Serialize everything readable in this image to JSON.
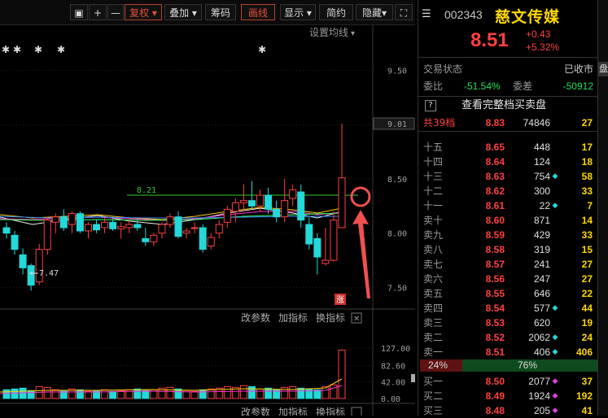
{
  "toolbar": {
    "buttons": [
      "复权",
      "叠加",
      "筹码",
      "画线",
      "显示",
      "简约",
      "隐藏"
    ],
    "active": [
      "复权",
      "画线"
    ]
  },
  "chart": {
    "ma_setting": "设置均线",
    "y_ticks": [
      "9.50",
      "9.00",
      "8.50",
      "8.00",
      "7.50"
    ],
    "current_price_tag": "9.01",
    "hline_label": "8.21",
    "low_label": "7.47",
    "limit_badge": "涨",
    "sub_tools": [
      "改参数",
      "加指标",
      "换指标"
    ],
    "vol_ticks": [
      "127.00",
      "82.60",
      "42.00",
      "0.00"
    ]
  },
  "chart_data": {
    "type": "candlestick",
    "price_range": [
      7.3,
      9.7
    ],
    "ohlc": [
      {
        "o": 8.05,
        "h": 8.1,
        "l": 7.95,
        "c": 8.0
      },
      {
        "o": 7.98,
        "h": 8.02,
        "l": 7.8,
        "c": 7.85
      },
      {
        "o": 7.8,
        "h": 7.86,
        "l": 7.62,
        "c": 7.68
      },
      {
        "o": 7.7,
        "h": 7.72,
        "l": 7.47,
        "c": 7.52
      },
      {
        "o": 7.55,
        "h": 7.9,
        "l": 7.52,
        "c": 7.85
      },
      {
        "o": 7.85,
        "h": 8.15,
        "l": 7.8,
        "c": 8.12
      },
      {
        "o": 8.1,
        "h": 8.18,
        "l": 8.0,
        "c": 8.15
      },
      {
        "o": 8.15,
        "h": 8.22,
        "l": 8.02,
        "c": 8.05
      },
      {
        "o": 8.08,
        "h": 8.2,
        "l": 8.0,
        "c": 8.18
      },
      {
        "o": 8.18,
        "h": 8.2,
        "l": 8.0,
        "c": 8.02
      },
      {
        "o": 8.02,
        "h": 8.1,
        "l": 7.95,
        "c": 8.08
      },
      {
        "o": 8.08,
        "h": 8.12,
        "l": 8.0,
        "c": 8.03
      },
      {
        "o": 8.05,
        "h": 8.15,
        "l": 8.0,
        "c": 8.1
      },
      {
        "o": 8.1,
        "h": 8.15,
        "l": 8.02,
        "c": 8.04
      },
      {
        "o": 8.04,
        "h": 8.1,
        "l": 7.95,
        "c": 8.06
      },
      {
        "o": 8.05,
        "h": 8.12,
        "l": 8.0,
        "c": 8.08
      },
      {
        "o": 8.08,
        "h": 8.12,
        "l": 8.02,
        "c": 8.05
      },
      {
        "o": 7.95,
        "h": 8.05,
        "l": 7.88,
        "c": 7.92
      },
      {
        "o": 7.92,
        "h": 8.0,
        "l": 7.88,
        "c": 7.98
      },
      {
        "o": 8.0,
        "h": 8.1,
        "l": 7.95,
        "c": 8.08
      },
      {
        "o": 8.08,
        "h": 8.18,
        "l": 8.05,
        "c": 8.15
      },
      {
        "o": 8.15,
        "h": 8.2,
        "l": 7.95,
        "c": 7.97
      },
      {
        "o": 8.0,
        "h": 8.05,
        "l": 7.95,
        "c": 8.02
      },
      {
        "o": 8.05,
        "h": 8.1,
        "l": 8.0,
        "c": 8.05
      },
      {
        "o": 8.05,
        "h": 8.08,
        "l": 7.82,
        "c": 7.85
      },
      {
        "o": 7.88,
        "h": 8.0,
        "l": 7.85,
        "c": 7.96
      },
      {
        "o": 8.0,
        "h": 8.12,
        "l": 7.95,
        "c": 8.08
      },
      {
        "o": 8.1,
        "h": 8.25,
        "l": 8.05,
        "c": 8.22
      },
      {
        "o": 8.2,
        "h": 8.32,
        "l": 8.1,
        "c": 8.28
      },
      {
        "o": 8.28,
        "h": 8.45,
        "l": 8.2,
        "c": 8.3
      },
      {
        "o": 8.3,
        "h": 8.48,
        "l": 8.22,
        "c": 8.25
      },
      {
        "o": 8.25,
        "h": 8.4,
        "l": 8.2,
        "c": 8.35
      },
      {
        "o": 8.35,
        "h": 8.42,
        "l": 8.18,
        "c": 8.22
      },
      {
        "o": 8.22,
        "h": 8.3,
        "l": 8.1,
        "c": 8.15
      },
      {
        "o": 8.15,
        "h": 8.5,
        "l": 8.1,
        "c": 8.3
      },
      {
        "o": 8.32,
        "h": 8.45,
        "l": 8.25,
        "c": 8.4
      },
      {
        "o": 8.38,
        "h": 8.45,
        "l": 8.05,
        "c": 8.12
      },
      {
        "o": 8.08,
        "h": 8.15,
        "l": 7.85,
        "c": 7.9
      },
      {
        "o": 7.95,
        "h": 8.0,
        "l": 7.62,
        "c": 7.78
      },
      {
        "o": 7.72,
        "h": 8.05,
        "l": 7.7,
        "c": 7.75
      },
      {
        "o": 7.75,
        "h": 8.2,
        "l": 7.74,
        "c": 8.12
      },
      {
        "o": 8.05,
        "h": 9.01,
        "l": 8.05,
        "c": 8.51
      }
    ],
    "volumes": [
      22,
      24,
      26,
      20,
      30,
      28,
      22,
      20,
      24,
      22,
      18,
      20,
      22,
      18,
      20,
      22,
      24,
      20,
      22,
      26,
      28,
      24,
      20,
      18,
      22,
      24,
      26,
      30,
      28,
      32,
      30,
      24,
      26,
      22,
      28,
      30,
      26,
      24,
      22,
      30,
      34,
      122
    ]
  },
  "quote": {
    "code": "002343",
    "name": "慈文传媒",
    "price": "8.51",
    "change": "+0.43",
    "change_pct": "+5.32%",
    "status_label": "交易状态",
    "status_value": "已收市",
    "weibi_label": "委比",
    "weibi_value": "-51.54%",
    "weicha_label": "委差",
    "weicha_value": "-50912",
    "full_book": "查看完整档买卖盘",
    "help": "?",
    "total_label": "共39档",
    "total_price": "8.83",
    "total_vol": "74846",
    "total_count": "27",
    "asks": [
      {
        "label": "十五",
        "price": "8.65",
        "vol": "448",
        "mk": "",
        "cnt": "17"
      },
      {
        "label": "十四",
        "price": "8.64",
        "vol": "124",
        "mk": "",
        "cnt": "18"
      },
      {
        "label": "十三",
        "price": "8.63",
        "vol": "754",
        "mk": "◆",
        "cnt": "58"
      },
      {
        "label": "十二",
        "price": "8.62",
        "vol": "300",
        "mk": "",
        "cnt": "33"
      },
      {
        "label": "十一",
        "price": "8.61",
        "vol": "22",
        "mk": "◆",
        "cnt": "7"
      },
      {
        "label": "卖十",
        "price": "8.60",
        "vol": "871",
        "mk": "",
        "cnt": "14"
      },
      {
        "label": "卖九",
        "price": "8.59",
        "vol": "429",
        "mk": "",
        "cnt": "33"
      },
      {
        "label": "卖八",
        "price": "8.58",
        "vol": "319",
        "mk": "",
        "cnt": "15"
      },
      {
        "label": "卖七",
        "price": "8.57",
        "vol": "241",
        "mk": "",
        "cnt": "27"
      },
      {
        "label": "卖六",
        "price": "8.56",
        "vol": "247",
        "mk": "",
        "cnt": "27"
      },
      {
        "label": "卖五",
        "price": "8.55",
        "vol": "646",
        "mk": "",
        "cnt": "22"
      },
      {
        "label": "卖四",
        "price": "8.54",
        "vol": "577",
        "mk": "◆",
        "cnt": "44"
      },
      {
        "label": "卖三",
        "price": "8.53",
        "vol": "620",
        "mk": "",
        "cnt": "19"
      },
      {
        "label": "卖二",
        "price": "8.52",
        "vol": "2062",
        "mk": "◆",
        "cnt": "24"
      },
      {
        "label": "卖一",
        "price": "8.51",
        "vol": "406",
        "mk": "◆",
        "cnt": "406"
      }
    ],
    "ratio_sell": "24%",
    "ratio_buy": "76%",
    "bids": [
      {
        "label": "买一",
        "price": "8.50",
        "vol": "2077",
        "mk": "◆",
        "cnt": "37"
      },
      {
        "label": "买二",
        "price": "8.49",
        "vol": "1924",
        "mk": "◆",
        "cnt": "192"
      },
      {
        "label": "买三",
        "price": "8.48",
        "vol": "205",
        "mk": "◆",
        "cnt": "41"
      }
    ],
    "side_tab": "盘"
  },
  "colors": {
    "up": "#ff4040",
    "down": "#23d9d9",
    "accent": "#e8503a",
    "gold": "#ffd800"
  }
}
